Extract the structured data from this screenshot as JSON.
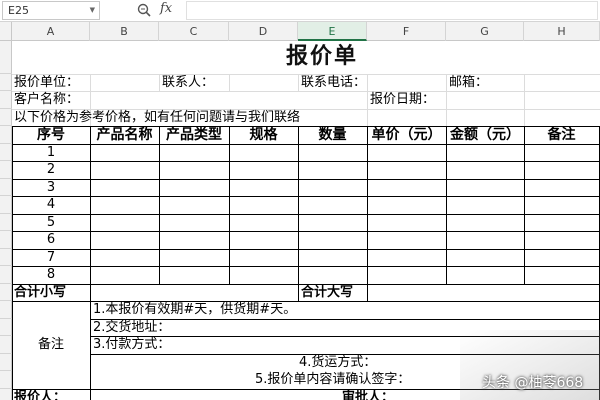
{
  "formula_bar": {
    "name_box": "E25",
    "fx_label": "fx",
    "formula": ""
  },
  "columns": [
    "A",
    "B",
    "C",
    "D",
    "E",
    "F",
    "G",
    "H"
  ],
  "active_column": "E",
  "title": "报价单",
  "info": {
    "supplier_label": "报价单位：",
    "contact_label": "联系人：",
    "phone_label": "联系电话：",
    "email_label": "邮箱：",
    "customer_label": "客户名称：",
    "date_label": "报价日期："
  },
  "note_line": "以下价格为参考价格，如有任何问题请与我们联络",
  "table": {
    "headers": [
      "序号",
      "产品名称",
      "产品类型",
      "规格",
      "数量",
      "单价（元）",
      "金额（元）",
      "备注"
    ],
    "rows": [
      "1",
      "2",
      "3",
      "4",
      "5",
      "6",
      "7",
      "8"
    ]
  },
  "totals": {
    "lower": "合计小写",
    "upper": "合计大写"
  },
  "remarks": {
    "label": "备注",
    "lines": [
      "1.本报价有效期#天，供货期#天。",
      "2.交货地址：",
      "3.付款方式：",
      "4.货运方式：",
      "5.报价单内容请确认签字："
    ]
  },
  "footer": {
    "quoter_label": "报价人：",
    "approver_label": "审批人："
  },
  "watermark": "头条 @柚苓668"
}
